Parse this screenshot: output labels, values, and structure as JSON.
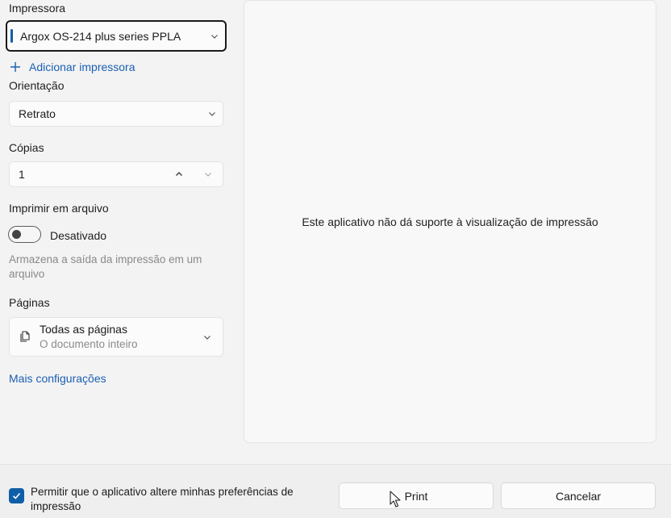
{
  "printer": {
    "label": "Impressora",
    "selected": "Argox OS-214 plus series PPLA",
    "add_printer": "Adicionar impressora"
  },
  "orientation": {
    "label": "Orientação",
    "selected": "Retrato"
  },
  "copies": {
    "label": "Cópias",
    "value": "1"
  },
  "print_to_file": {
    "label": "Imprimir em arquivo",
    "toggle_state": "Desativado",
    "help": "Armazena a saída da impressão em um arquivo"
  },
  "pages": {
    "label": "Páginas",
    "selected": "Todas as páginas",
    "description": "O documento inteiro"
  },
  "more_settings": "Mais configurações",
  "preview": {
    "message": "Este aplicativo não dá suporte à visualização de impressão"
  },
  "footer": {
    "checkbox_label": "Permitir que o aplicativo altere minhas preferências de impressão",
    "checkbox_checked": true,
    "print_button": "Print",
    "cancel_button": "Cancelar"
  },
  "colors": {
    "accent": "#0f5fa8",
    "link": "#1a5fb4"
  },
  "icons": [
    "chevron-down-icon",
    "plus-icon",
    "chevron-up-icon",
    "document-pages-icon",
    "checkmark-icon",
    "mouse-cursor-icon"
  ]
}
